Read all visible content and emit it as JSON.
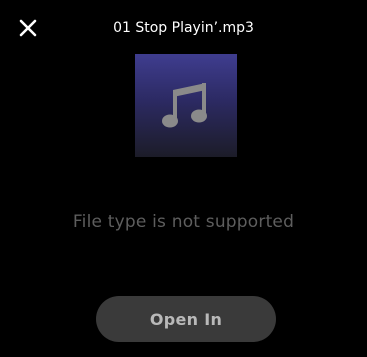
{
  "header": {
    "title": "01 Stop Playin’.mp3",
    "close_icon": "close-icon"
  },
  "artwork": {
    "icon": "music-note-icon",
    "gradient_top": "#3f3d8f",
    "gradient_bottom": "#1c1c28",
    "icon_color": "#8a8a8a"
  },
  "message": {
    "text": "File type is not supported"
  },
  "actions": {
    "open_in_label": "Open In"
  },
  "colors": {
    "background": "#000000",
    "button_bg": "#3a3a3a",
    "button_text": "#b9b9b9",
    "message_text": "#5e5e5e"
  }
}
